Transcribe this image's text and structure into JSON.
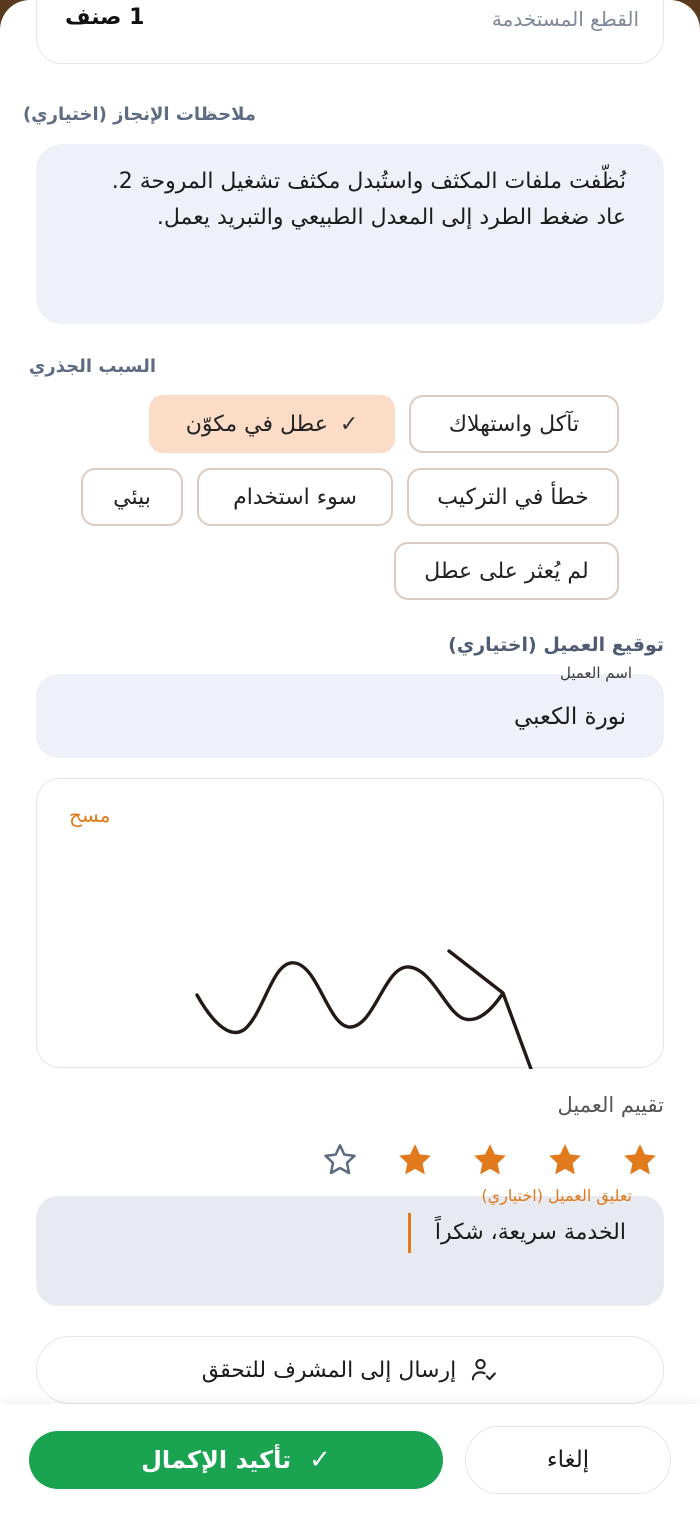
{
  "top_field": {
    "label": "القطع المستخدمة",
    "value": "1 صنف"
  },
  "notes": {
    "label": "ملاحظات الإنجاز (اختياري)",
    "lines": [
      "نُظّفت ملفات المكثف واستُبدل مكثف تشغيل المروحة 2.",
      "عاد ضغط الطرد إلى المعدل الطبيعي والتبريد يعمل."
    ]
  },
  "root_cause": {
    "label": "السبب الجذري",
    "chips": [
      {
        "label": "تآكل واستهلاك",
        "selected": false
      },
      {
        "label": "عطل في مكوّن",
        "selected": true
      },
      {
        "label": "خطأ في التركيب",
        "selected": false
      },
      {
        "label": "سوء استخدام",
        "selected": false
      },
      {
        "label": "بيئي",
        "selected": false
      },
      {
        "label": "لم يُعثر على عطل",
        "selected": false
      }
    ]
  },
  "signature": {
    "label": "توقيع العميل (اختياري)",
    "name_label": "اسم العميل",
    "name_value": "نورة الكعبي",
    "clear_label": "مسح"
  },
  "rating": {
    "label": "تقييم العميل",
    "value": 4,
    "max": 5
  },
  "comment": {
    "label": "تعليق العميل (اختياري)",
    "value": "الخدمة سريعة، شكراً"
  },
  "send_button": {
    "label": "إرسال إلى المشرف للتحقق",
    "icon": "user-check-icon"
  },
  "actions": {
    "confirm_label": "تأكيد الإكمال",
    "cancel_label": "إلغاء"
  },
  "colors": {
    "accent": "#e07a1c",
    "confirm": "#1aa350",
    "selected_chip": "#fbdcc7",
    "field_bg": "#eef1f7"
  }
}
